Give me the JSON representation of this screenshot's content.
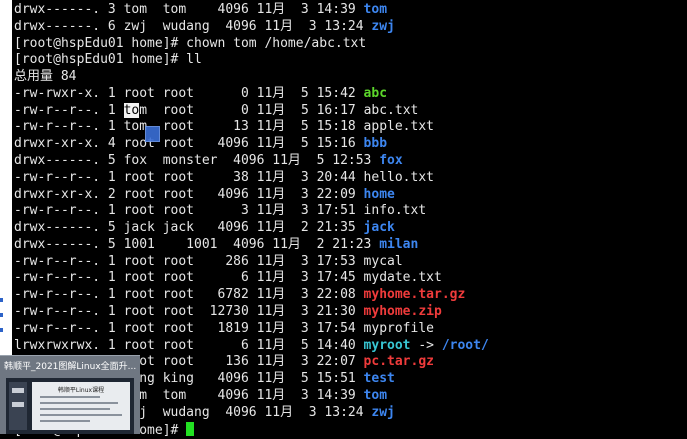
{
  "terminal": {
    "lines": [
      {
        "prefix": "drwx------. 3 tom  tom    4096 11月  3 14:39 ",
        "name": "tom",
        "kind": "dir"
      },
      {
        "prefix": "drwx------. 6 zwj  wudang  4096 11月  3 13:24 ",
        "name": "zwj",
        "kind": "dir"
      },
      {
        "prefix": "[root@hspEdu01 home]# chown tom /home/abc.txt",
        "name": "",
        "kind": "plain"
      },
      {
        "prefix": "[root@hspEdu01 home]# ll",
        "name": "",
        "kind": "plain"
      },
      {
        "prefix": "总用量 84",
        "name": "",
        "kind": "plain"
      },
      {
        "prefix": "-rw-rwxr-x. 1 root root      0 11月  5 15:42 ",
        "name": "abc",
        "kind": "exe"
      },
      {
        "prefix": "-rw-r--r--. 1 tom  root      0 11月  5 16:17 ",
        "name": "abc.txt",
        "kind": "plain"
      },
      {
        "prefix": "-rw-r--r--. 1 tom  root     13 11月  5 15:18 ",
        "name": "apple.txt",
        "kind": "plain"
      },
      {
        "prefix": "drwxr-xr-x. 4 root root   4096 11月  5 15:16 ",
        "name": "bbb",
        "kind": "dir"
      },
      {
        "prefix": "drwx------. 5 fox  monster  4096 11月  5 12:53 ",
        "name": "fox",
        "kind": "dir"
      },
      {
        "prefix": "-rw-r--r--. 1 root root     38 11月  3 20:44 ",
        "name": "hello.txt",
        "kind": "plain"
      },
      {
        "prefix": "drwxr-xr-x. 2 root root   4096 11月  3 22:09 ",
        "name": "home",
        "kind": "dir"
      },
      {
        "prefix": "-rw-r--r--. 1 root root      3 11月  3 17:51 ",
        "name": "info.txt",
        "kind": "plain"
      },
      {
        "prefix": "drwx------. 5 jack jack   4096 11月  2 21:35 ",
        "name": "jack",
        "kind": "dir"
      },
      {
        "prefix": "drwx------. 5 1001    1001  4096 11月  2 21:23 ",
        "name": "milan",
        "kind": "dir"
      },
      {
        "prefix": "-rw-r--r--. 1 root root    286 11月  3 17:53 ",
        "name": "mycal",
        "kind": "plain"
      },
      {
        "prefix": "-rw-r--r--. 1 root root      6 11月  3 17:45 ",
        "name": "mydate.txt",
        "kind": "plain"
      },
      {
        "prefix": "-rw-r--r--. 1 root root   6782 11月  3 22:08 ",
        "name": "myhome.tar.gz",
        "kind": "arc"
      },
      {
        "prefix": "-rw-r--r--. 1 root root  12730 11月  3 21:30 ",
        "name": "myhome.zip",
        "kind": "arc"
      },
      {
        "prefix": "-rw-r--r--. 1 root root   1819 11月  3 17:54 ",
        "name": "myprofile",
        "kind": "plain"
      },
      {
        "prefix": "lrwxrwxrwx. 1 root root      6 11月  5 14:40 ",
        "name": "myroot",
        "kind": "lnk",
        "suffix": " -> ",
        "target": "/root/"
      },
      {
        "prefix": "-rw-r--r--. 1 root root    136 11月  3 22:07 ",
        "name": "pc.tar.gz",
        "kind": "arc"
      },
      {
        "prefix": "drwx------. 3 king king   4096 11月  5 15:51 ",
        "name": "test",
        "kind": "dir"
      },
      {
        "prefix": "drwx------. 3 tom  tom    4096 11月  3 14:39 ",
        "name": "tom",
        "kind": "dir"
      },
      {
        "prefix": "drwx------. 6 zwj  wudang  4096 11月  3 13:24 ",
        "name": "zwj",
        "kind": "dir"
      },
      {
        "prefix": "[root@hspEdu01 home]# ",
        "name": "",
        "kind": "prompt"
      }
    ]
  },
  "thumbnail": {
    "title": "韩顺平_2021图解Linux全面升...",
    "doc_title": "韩顺平Linux课程"
  },
  "colors": {
    "background": "#000000",
    "text": "#e6e6e6",
    "directory": "#3d86f0",
    "executable": "#5cd62b",
    "archive": "#ef3b3b",
    "symlink": "#38c6d3",
    "cursor": "#22e022"
  }
}
